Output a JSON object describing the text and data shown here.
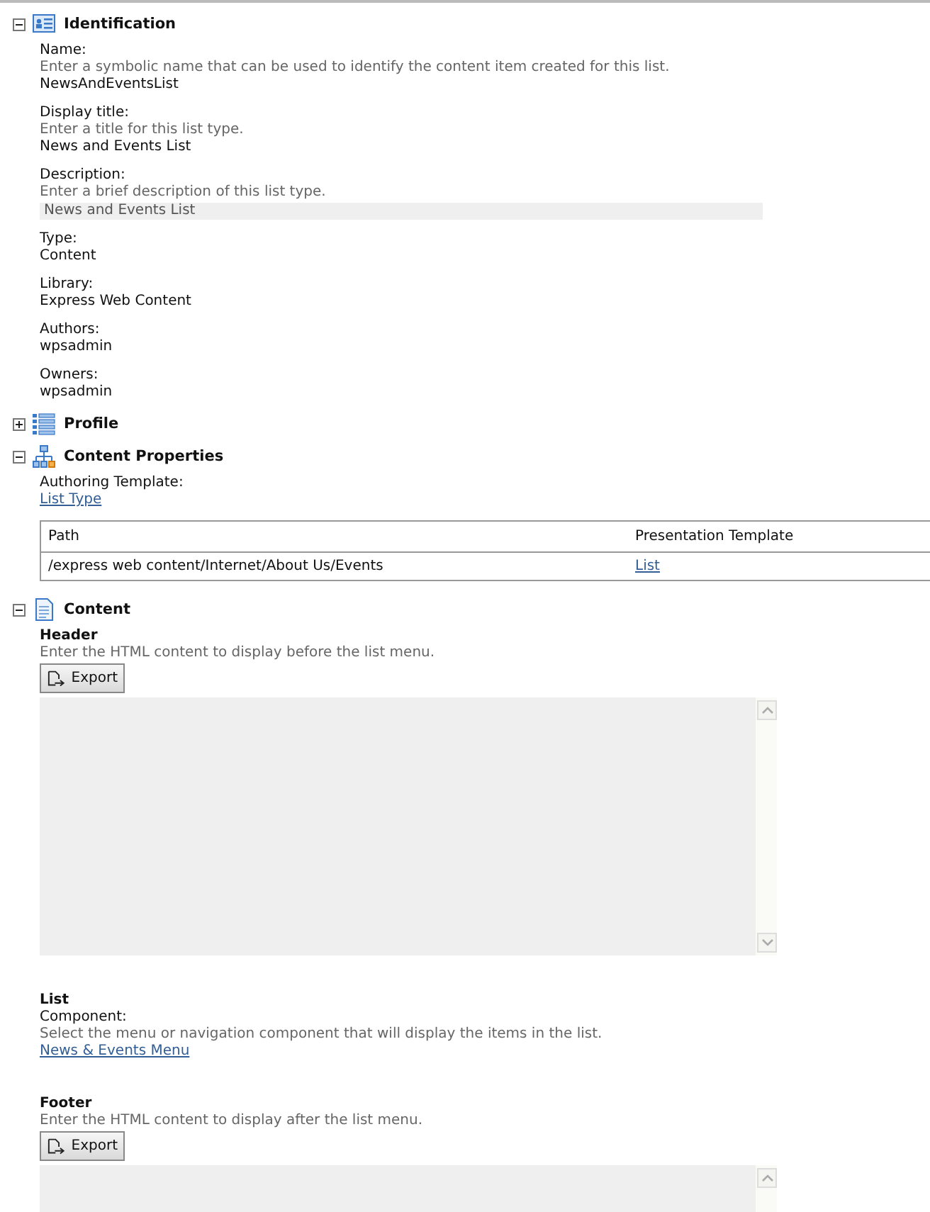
{
  "sections": [
    {
      "kind": "identification",
      "title": "Identification",
      "expanded": true,
      "fields": [
        {
          "kind": "text",
          "label": "Name:",
          "hint": "Enter a symbolic name that can be used to identify the content item created for this list.",
          "value": "NewsAndEventsList"
        },
        {
          "kind": "text",
          "label": "Display title:",
          "hint": "Enter a title for this list type.",
          "value": "News and Events List"
        },
        {
          "kind": "field",
          "label": "Description:",
          "hint": "Enter a brief description of this list type.",
          "value": "News and Events List"
        },
        {
          "kind": "text",
          "label": "Type:",
          "value": "Content"
        },
        {
          "kind": "text",
          "label": "Library:",
          "value": "Express Web Content"
        },
        {
          "kind": "text",
          "label": "Authors:",
          "value": "wpsadmin"
        },
        {
          "kind": "text",
          "label": "Owners:",
          "value": "wpsadmin"
        }
      ]
    },
    {
      "kind": "profile",
      "title": "Profile",
      "expanded": false
    },
    {
      "kind": "properties",
      "title": "Content Properties",
      "expanded": true,
      "template_label": "Authoring Template:",
      "template_link": "List Type",
      "table": {
        "columns": [
          "Path",
          "Presentation Template"
        ],
        "rows": [
          [
            "/express web content/Internet/About Us/Events",
            "List"
          ]
        ]
      }
    },
    {
      "kind": "content",
      "title": "Content",
      "expanded": true,
      "parts": [
        {
          "kind": "html",
          "title": "Header",
          "hint": "Enter the HTML content to display before the list menu.",
          "button": "Export"
        },
        {
          "kind": "component",
          "title": "List",
          "label": "Component:",
          "hint": "Select the menu or navigation component that will display the items in the list.",
          "link": "News & Events Menu"
        },
        {
          "kind": "html",
          "title": "Footer",
          "hint": "Enter the HTML content to display after the list menu.",
          "button": "Export"
        }
      ]
    }
  ]
}
